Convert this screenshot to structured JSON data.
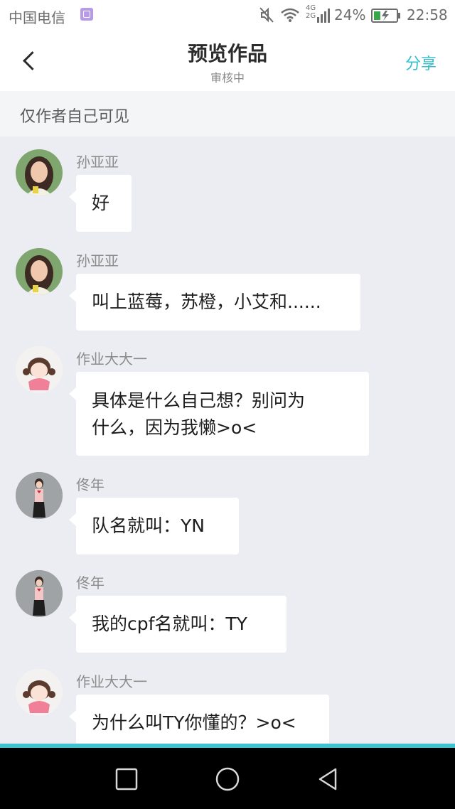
{
  "status_bar": {
    "carrier": "中国电信",
    "network_top": "4G",
    "network_bottom": "2G",
    "battery_percent": "24%",
    "time": "22:58"
  },
  "header": {
    "title": "预览作品",
    "subtitle": "审核中",
    "share_label": "分享"
  },
  "notice": "仅作者自己可见",
  "messages": [
    {
      "sender": "孙亚亚",
      "text": "好"
    },
    {
      "sender": "孙亚亚",
      "text": "叫上蓝莓，苏橙，小艾和......"
    },
    {
      "sender": "作业大大一",
      "text_line1": "具体是什么自己想？别问为",
      "text_line2": "什么，因为我懒>o<"
    },
    {
      "sender": "佟年",
      "text": "队名就叫：YN"
    },
    {
      "sender": "佟年",
      "text": "我的cpf名就叫：TY"
    },
    {
      "sender": "作业大大一",
      "text": "为什么叫TY你懂的？>o<"
    }
  ],
  "colors": {
    "accent": "#35bfcc",
    "chat_background": "#ebedf2",
    "bubble": "#ffffff"
  }
}
